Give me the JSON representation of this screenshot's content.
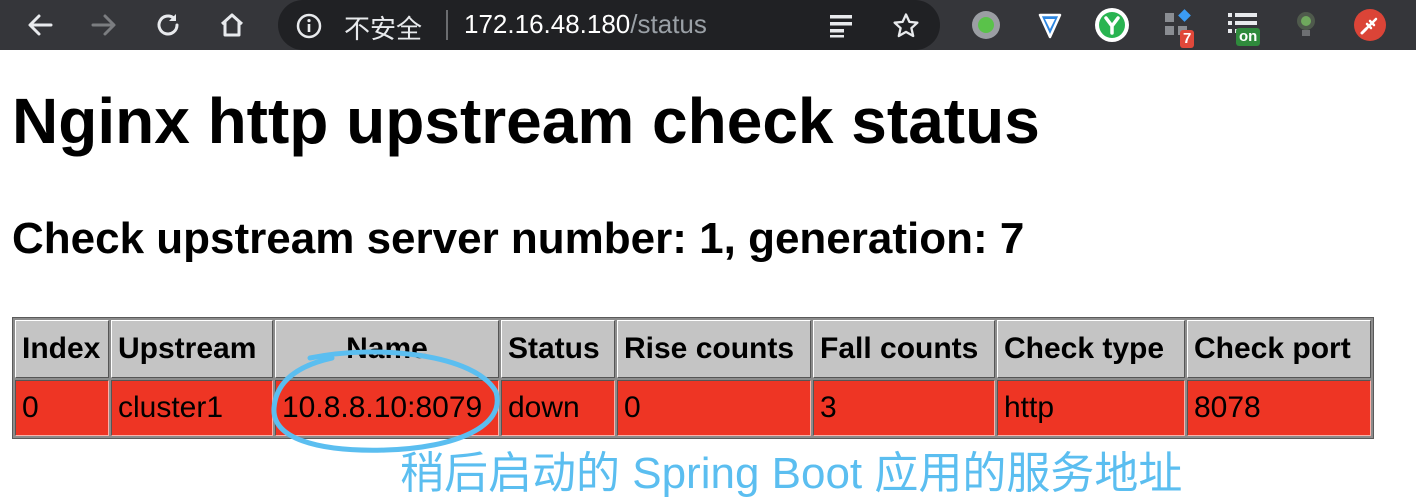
{
  "browser": {
    "security_label": "不安全",
    "url_host": "172.16.48.180",
    "url_path": "/status",
    "extensions": [
      {
        "name": "green-dot-extension-icon"
      },
      {
        "name": "shield-extension-icon"
      },
      {
        "name": "y-extension-icon"
      },
      {
        "name": "grid-extension-icon",
        "badge": "7"
      },
      {
        "name": "list-extension-icon",
        "badge": "on"
      },
      {
        "name": "bulb-extension-icon"
      },
      {
        "name": "plug-extension-icon"
      }
    ]
  },
  "page": {
    "title": "Nginx http upstream check status",
    "subtitle": "Check upstream server number: 1, generation: 7"
  },
  "table": {
    "headers": [
      "Index",
      "Upstream",
      "Name",
      "Status",
      "Rise counts",
      "Fall counts",
      "Check type",
      "Check port"
    ],
    "rows": [
      [
        "0",
        "cluster1",
        "10.8.8.10:8079",
        "down",
        "0",
        "3",
        "http",
        "8078"
      ]
    ]
  },
  "annotation": {
    "text": "稍后启动的 Spring Boot 应用的服务地址",
    "color": "#5bbef0"
  },
  "colors": {
    "row_down": "#ee3524",
    "header_bg": "#c4c4c4",
    "toolbar_bg": "#35363a"
  }
}
